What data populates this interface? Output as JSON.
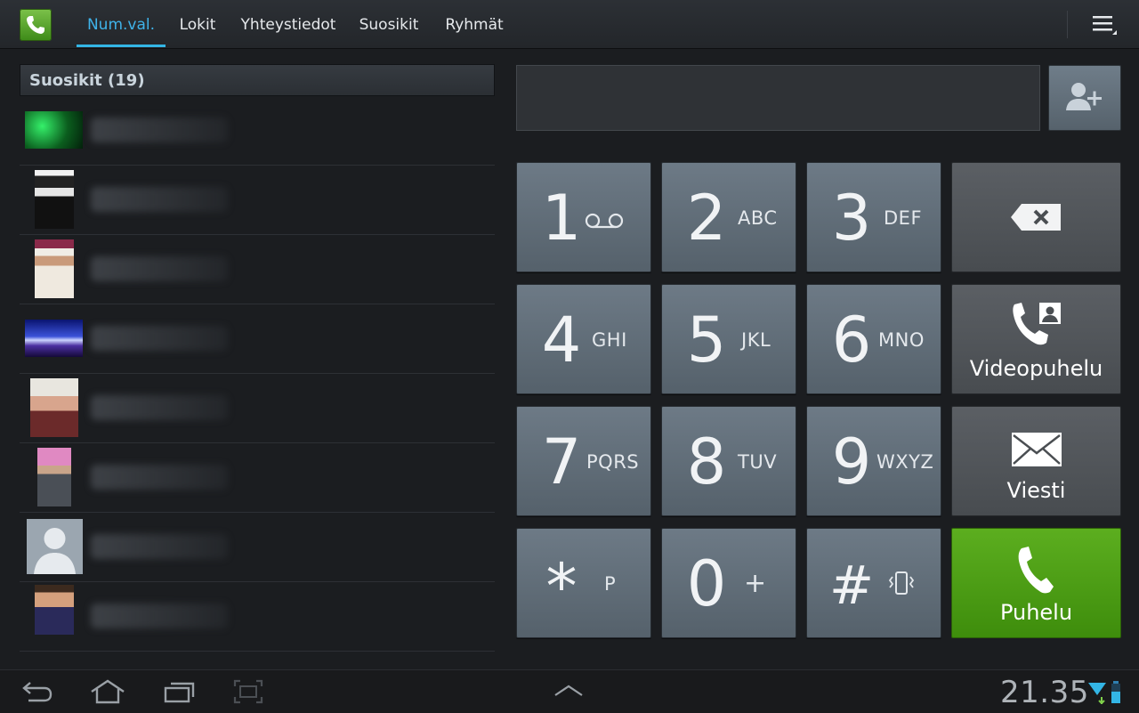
{
  "topbar": {
    "app_icon": "phone-icon",
    "tabs": [
      {
        "label": "Num.val.",
        "active": true
      },
      {
        "label": "Lokit",
        "active": false
      },
      {
        "label": "Yhteystiedot",
        "active": false
      },
      {
        "label": "Suosikit",
        "active": false
      },
      {
        "label": "Ryhmät",
        "active": false
      }
    ],
    "menu_icon": "overflow-menu-icon"
  },
  "favorites": {
    "header": "Suosikit (19)",
    "items": [
      {
        "thumb": "green-photo"
      },
      {
        "thumb": "bw-portrait"
      },
      {
        "thumb": "white-hat-portrait"
      },
      {
        "thumb": "concert-photo"
      },
      {
        "thumb": "winter-hat-portrait"
      },
      {
        "thumb": "pink-umbrella-photo"
      },
      {
        "thumb": "default-avatar"
      },
      {
        "thumb": "man-portrait"
      }
    ]
  },
  "dialer": {
    "number_value": "",
    "add_contact_icon": "add-contact-icon",
    "keys": [
      {
        "digit": "1",
        "letters": "",
        "icon": "voicemail-icon"
      },
      {
        "digit": "2",
        "letters": "ABC"
      },
      {
        "digit": "3",
        "letters": "DEF"
      },
      {
        "digit": "4",
        "letters": "GHI"
      },
      {
        "digit": "5",
        "letters": "JKL"
      },
      {
        "digit": "6",
        "letters": "MNO"
      },
      {
        "digit": "7",
        "letters": "PQRS"
      },
      {
        "digit": "8",
        "letters": "TUV"
      },
      {
        "digit": "9",
        "letters": "WXYZ"
      },
      {
        "digit": "*",
        "letters": "P"
      },
      {
        "digit": "0",
        "letters": "+"
      },
      {
        "digit": "#",
        "letters": "",
        "icon": "vibrate-icon"
      }
    ],
    "backspace_icon": "backspace-icon",
    "video_call_label": "Videopuhelu",
    "message_label": "Viesti",
    "call_label": "Puhelu",
    "call_color": "#4a9b12"
  },
  "systembar": {
    "clock": "21.35",
    "icons": [
      "back-icon",
      "home-icon",
      "recent-apps-icon",
      "screenshot-icon",
      "up-arrow-icon",
      "wifi-icon",
      "battery-icon"
    ]
  }
}
